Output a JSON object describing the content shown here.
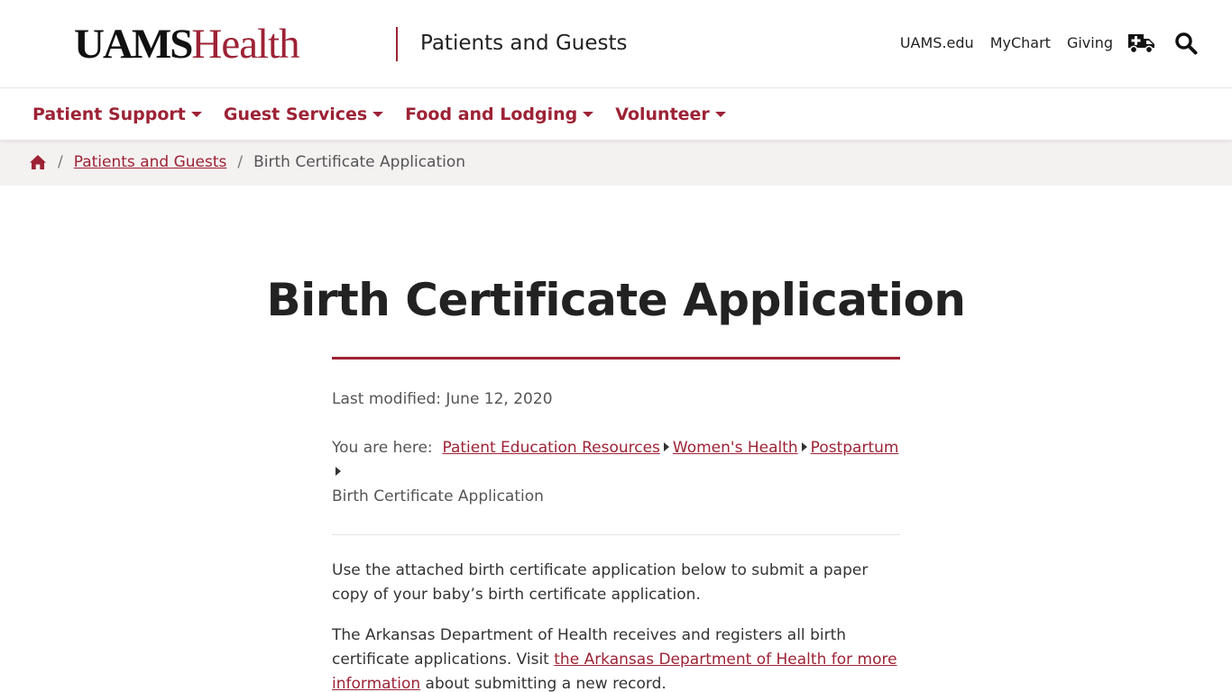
{
  "header": {
    "logo_uams": "UAMS",
    "logo_health": "Health",
    "section_title": "Patients and Guests",
    "utility_links": [
      "UAMS.edu",
      "MyChart",
      "Giving"
    ],
    "ambulance_icon": "ambulance-icon",
    "search_icon": "search-icon"
  },
  "nav": {
    "items": [
      {
        "label": "Patient Support"
      },
      {
        "label": "Guest Services"
      },
      {
        "label": "Food and Lodging"
      },
      {
        "label": "Volunteer"
      }
    ]
  },
  "breadcrumb": {
    "home_icon": "home-icon",
    "link": "Patients and Guests",
    "current": "Birth Certificate Application"
  },
  "page": {
    "title": "Birth Certificate Application",
    "last_modified": "Last modified: June 12, 2020",
    "you_are_here_label": "You are here:",
    "trail": [
      "Patient Education Resources",
      "Women's Health",
      "Postpartum"
    ],
    "trail_current": "Birth Certificate Application",
    "paragraph1": "Use the attached birth certificate application below to submit a paper copy of your baby’s birth certificate application.",
    "paragraph2_before": "The Arkansas Department of Health receives and registers all birth certificate applications. Visit ",
    "paragraph2_link": "the Arkansas Department of Health for more information",
    "paragraph2_after": " about submitting a new record."
  },
  "colors": {
    "brand": "#9d2235",
    "text": "#333333",
    "breadcrumb_bg": "#f4f1f1"
  }
}
